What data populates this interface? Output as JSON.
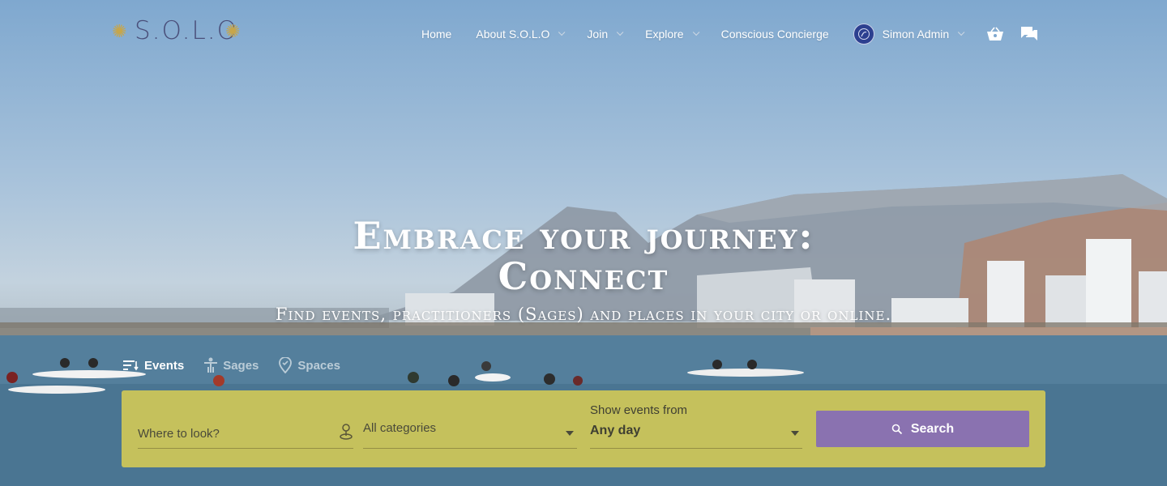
{
  "brand": {
    "logo_text": "S.O.L.O",
    "logo_subtext": "",
    "colors": {
      "logo": "#4a4f7a",
      "accent_gold": "#c7a64a",
      "search_panel": "#d6cc54",
      "search_button": "#8a72b0",
      "avatar": "#2c3f8f"
    }
  },
  "nav": {
    "items": [
      {
        "label": "Home",
        "has_dropdown": false
      },
      {
        "label": "About S.O.L.O",
        "has_dropdown": true
      },
      {
        "label": "Join",
        "has_dropdown": true
      },
      {
        "label": "Explore",
        "has_dropdown": true
      },
      {
        "label": "Conscious Concierge",
        "has_dropdown": false
      }
    ],
    "user": {
      "name": "Simon Admin",
      "has_dropdown": true,
      "icon": "avatar"
    },
    "cart_icon": "basket-icon",
    "messages_icon": "chat-icon"
  },
  "hero": {
    "title_line1": "Embrace your journey:",
    "title_line2": "Connect",
    "subtitle": "Find events, practitioners (Sages) and places in your city or online."
  },
  "search": {
    "tabs": [
      {
        "label": "Events",
        "icon": "events-icon",
        "active": true
      },
      {
        "label": "Sages",
        "icon": "person-icon",
        "active": false
      },
      {
        "label": "Spaces",
        "icon": "location-pin-icon",
        "active": false
      }
    ],
    "where_placeholder": "Where to look?",
    "category_value": "All categories",
    "date_label": "Show events from",
    "date_value": "Any day",
    "button_label": "Search"
  }
}
